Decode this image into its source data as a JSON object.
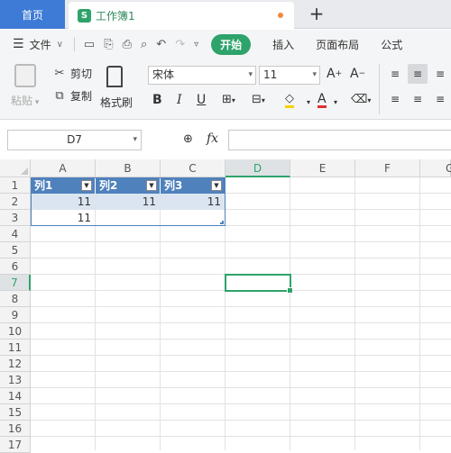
{
  "tabs": {
    "home_label": "首页",
    "doc_icon": "S",
    "doc_title": "工作簿1",
    "new_tab": "+"
  },
  "menu": {
    "file_label": "文件",
    "start_label": "开始",
    "items": [
      "插入",
      "页面布局",
      "公式"
    ]
  },
  "ribbon": {
    "paste_label": "粘贴",
    "cut_label": "剪切",
    "copy_label": "复制",
    "format_painter_label": "格式刷",
    "font_name": "宋体",
    "font_size": "11",
    "bold": "B",
    "italic": "I",
    "underline": "U",
    "font_color_glyph": "A",
    "grow_font": "A+",
    "shrink_font": "A-"
  },
  "formula_bar": {
    "name_box": "D7",
    "fx_label": "fx",
    "formula": ""
  },
  "sheet": {
    "columns": [
      "A",
      "B",
      "C",
      "D",
      "E",
      "F",
      "G"
    ],
    "rows": [
      "1",
      "2",
      "3",
      "4",
      "5",
      "6",
      "7",
      "8",
      "9",
      "10",
      "11",
      "12",
      "13",
      "14",
      "15",
      "16",
      "17"
    ],
    "active_col": "D",
    "active_row": "7",
    "table_headers": [
      "列1",
      "列2",
      "列3"
    ],
    "row2": [
      "11",
      "11",
      "11"
    ],
    "row3": [
      "11",
      "",
      ""
    ]
  },
  "colors": {
    "accent": "#2ea36b",
    "table_header": "#4f81bd",
    "table_band": "#dbe5f1",
    "home_tab": "#3d7bd6"
  }
}
